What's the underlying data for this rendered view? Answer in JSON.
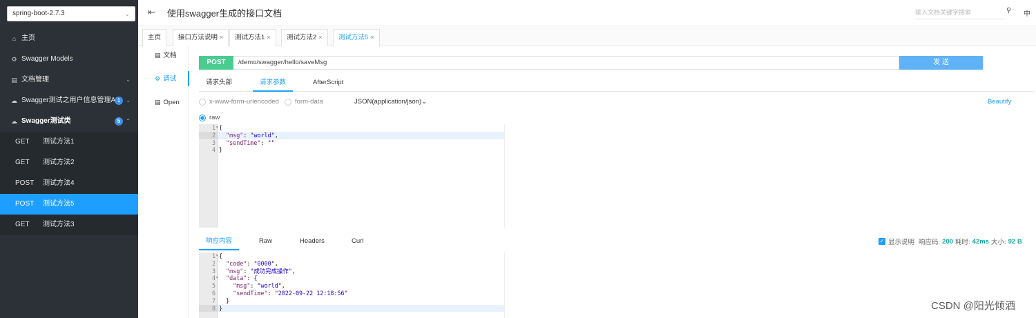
{
  "sidebar": {
    "version_select": "spring-boot-2.7.3",
    "menu": [
      {
        "label": "主页",
        "icon": "home-icon"
      },
      {
        "label": "Swagger Models",
        "icon": "gear-icon"
      },
      {
        "label": "文档管理",
        "icon": "doc-icon"
      },
      {
        "label": "Swagger测试之用户信息管理API",
        "icon": "cloud-icon",
        "badge": "1"
      },
      {
        "label": "Swagger测试类",
        "icon": "cloud-icon",
        "badge": "5"
      }
    ],
    "sub_items": [
      {
        "method": "GET",
        "name": "测试方法1"
      },
      {
        "method": "GET",
        "name": "测试方法2"
      },
      {
        "method": "POST",
        "name": "测试方法4"
      },
      {
        "method": "POST",
        "name": "测试方法5"
      },
      {
        "method": "GET",
        "name": "测试方法3"
      }
    ]
  },
  "header": {
    "title": "使用swagger生成的接口文档",
    "search_placeholder": "输入文档关键字搜索",
    "lang": "中"
  },
  "tabs": [
    {
      "label": "主页"
    },
    {
      "label": "接口方法说明",
      "close": "×"
    },
    {
      "label": "测试方法1",
      "close": "×"
    },
    {
      "label": "测试方法2",
      "close": "×"
    },
    {
      "label": "测试方法5",
      "close": "×"
    }
  ],
  "left_nav": [
    {
      "label": "文档",
      "icon": "doc-icon"
    },
    {
      "label": "调试",
      "icon": "debug-icon"
    },
    {
      "label": "Open",
      "icon": "file-icon"
    }
  ],
  "request": {
    "method": "POST",
    "url": "/demo/swagger/hello/saveMsg",
    "send_label": "发 送",
    "sub_tabs": [
      "请求头部",
      "请求参数",
      "AfterScript"
    ],
    "body_types": [
      "x-www-form-urlencoded",
      "form-data"
    ],
    "content_type": "JSON(application/json)",
    "beautify": "Beautify",
    "raw_label": "raw",
    "code_line_numbers": [
      "1",
      "2",
      "3",
      "4"
    ]
  },
  "response": {
    "tabs": [
      "响应内容",
      "Raw",
      "Headers",
      "Curl"
    ],
    "show_desc_label": "显示说明",
    "status_label": "响应码:",
    "status_value": "200",
    "time_label": "耗时:",
    "time_value": "42ms",
    "size_label": "大小:",
    "size_value": "92 B",
    "code_line_numbers": [
      "1",
      "2",
      "3",
      "4",
      "5",
      "6",
      "7",
      "8"
    ]
  },
  "watermark": "CSDN @阳光倾洒",
  "colors": {
    "accent": "#1e9fff",
    "post": "#49cc90",
    "sidebar": "#2b3136"
  }
}
